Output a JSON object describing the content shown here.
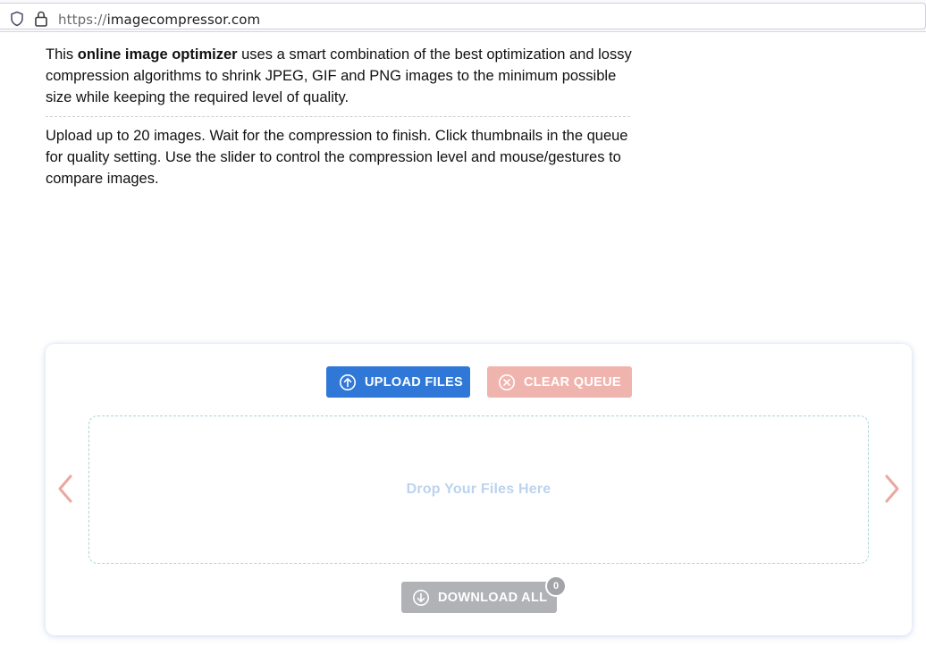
{
  "browser": {
    "url_scheme": "https://",
    "url_host": "imagecompressor.com"
  },
  "intro": {
    "p1_pre": "This ",
    "p1_bold": "online image optimizer",
    "p1_post": " uses a smart combination of the best optimization and lossy compression algorithms to shrink JPEG, GIF and PNG images to the minimum possible size while keeping the required level of quality.",
    "p2": "Upload up to 20 images. Wait for the compression to finish. Click thumbnails in the queue for quality setting. Use the slider to control the compression level and mouse/gestures to compare images."
  },
  "uploader": {
    "upload_label": "UPLOAD FILES",
    "clear_label": "CLEAR QUEUE",
    "drop_label": "Drop Your Files Here",
    "download_label": "DOWNLOAD ALL",
    "download_count": "0"
  },
  "colors": {
    "upload_button": "#2f78d8",
    "clear_button": "#f0b4ae",
    "download_button": "#b0b2b5",
    "nav_arrow": "#eaa89e",
    "dropzone_border": "#a9d6d8"
  },
  "icons": {
    "security": "shield-icon",
    "lock": "lock-icon",
    "upload": "arrow-up-circle-icon",
    "clear": "x-circle-icon",
    "download": "arrow-down-circle-icon",
    "prev": "chevron-left-icon",
    "next": "chevron-right-icon"
  }
}
